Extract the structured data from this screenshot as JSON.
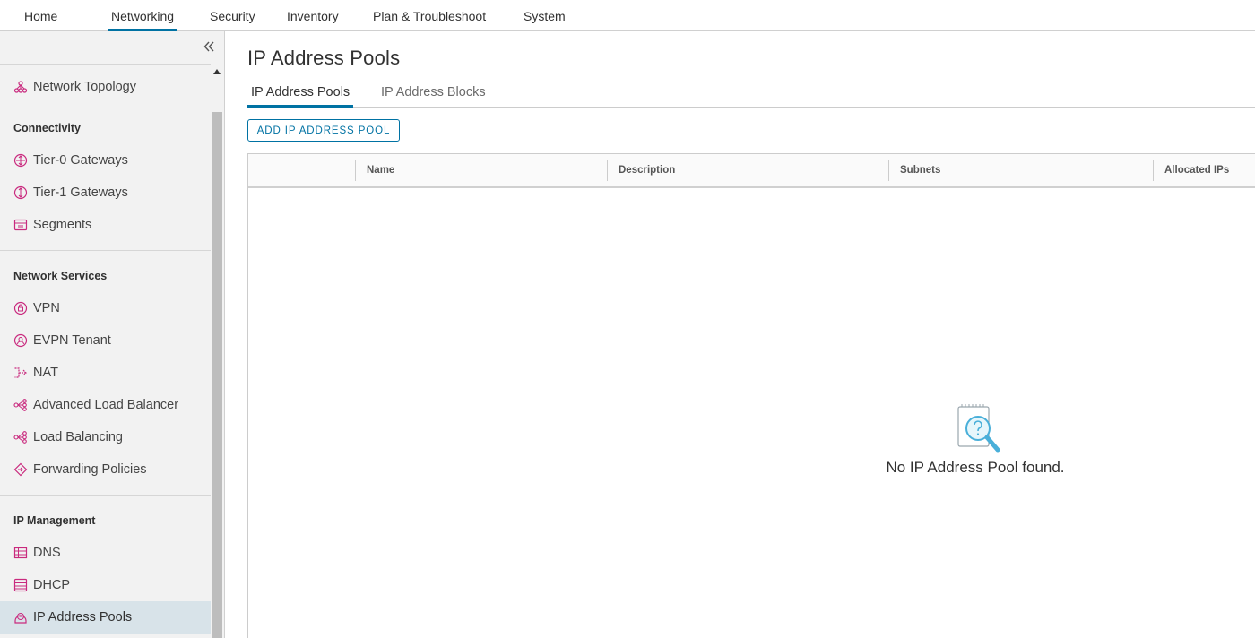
{
  "topnav": {
    "items": [
      {
        "label": "Home"
      },
      {
        "label": "Networking",
        "active": true
      },
      {
        "label": "Security"
      },
      {
        "label": "Inventory"
      },
      {
        "label": "Plan & Troubleshoot"
      },
      {
        "label": "System"
      }
    ]
  },
  "sidebar": {
    "top_item": {
      "label": "Network Topology",
      "icon": "network-topology-icon"
    },
    "sections": [
      {
        "title": "Connectivity",
        "items": [
          {
            "label": "Tier-0 Gateways",
            "icon": "tier0-gateway-icon"
          },
          {
            "label": "Tier-1 Gateways",
            "icon": "tier1-gateway-icon"
          },
          {
            "label": "Segments",
            "icon": "segments-icon"
          }
        ]
      },
      {
        "title": "Network Services",
        "items": [
          {
            "label": "VPN",
            "icon": "vpn-icon"
          },
          {
            "label": "EVPN Tenant",
            "icon": "evpn-tenant-icon"
          },
          {
            "label": "NAT",
            "icon": "nat-icon"
          },
          {
            "label": "Advanced Load Balancer",
            "icon": "advanced-load-balancer-icon"
          },
          {
            "label": "Load Balancing",
            "icon": "load-balancing-icon"
          },
          {
            "label": "Forwarding Policies",
            "icon": "forwarding-policies-icon"
          }
        ]
      },
      {
        "title": "IP Management",
        "items": [
          {
            "label": "DNS",
            "icon": "dns-icon"
          },
          {
            "label": "DHCP",
            "icon": "dhcp-icon"
          },
          {
            "label": "IP Address Pools",
            "icon": "ip-address-pools-icon",
            "active": true
          }
        ]
      }
    ]
  },
  "main": {
    "title": "IP Address Pools",
    "tabs": [
      {
        "label": "IP Address Pools",
        "active": true
      },
      {
        "label": "IP Address Blocks"
      }
    ],
    "add_button": "ADD IP ADDRESS POOL",
    "columns": [
      "Name",
      "Description",
      "Subnets",
      "Allocated IPs"
    ],
    "empty_message": "No IP Address Pool found."
  },
  "colors": {
    "accent": "#0072a3",
    "icon_pink": "#c92a7e",
    "sidebar_bg": "#f2f2f2",
    "active_item_bg": "#d8e3e9"
  }
}
